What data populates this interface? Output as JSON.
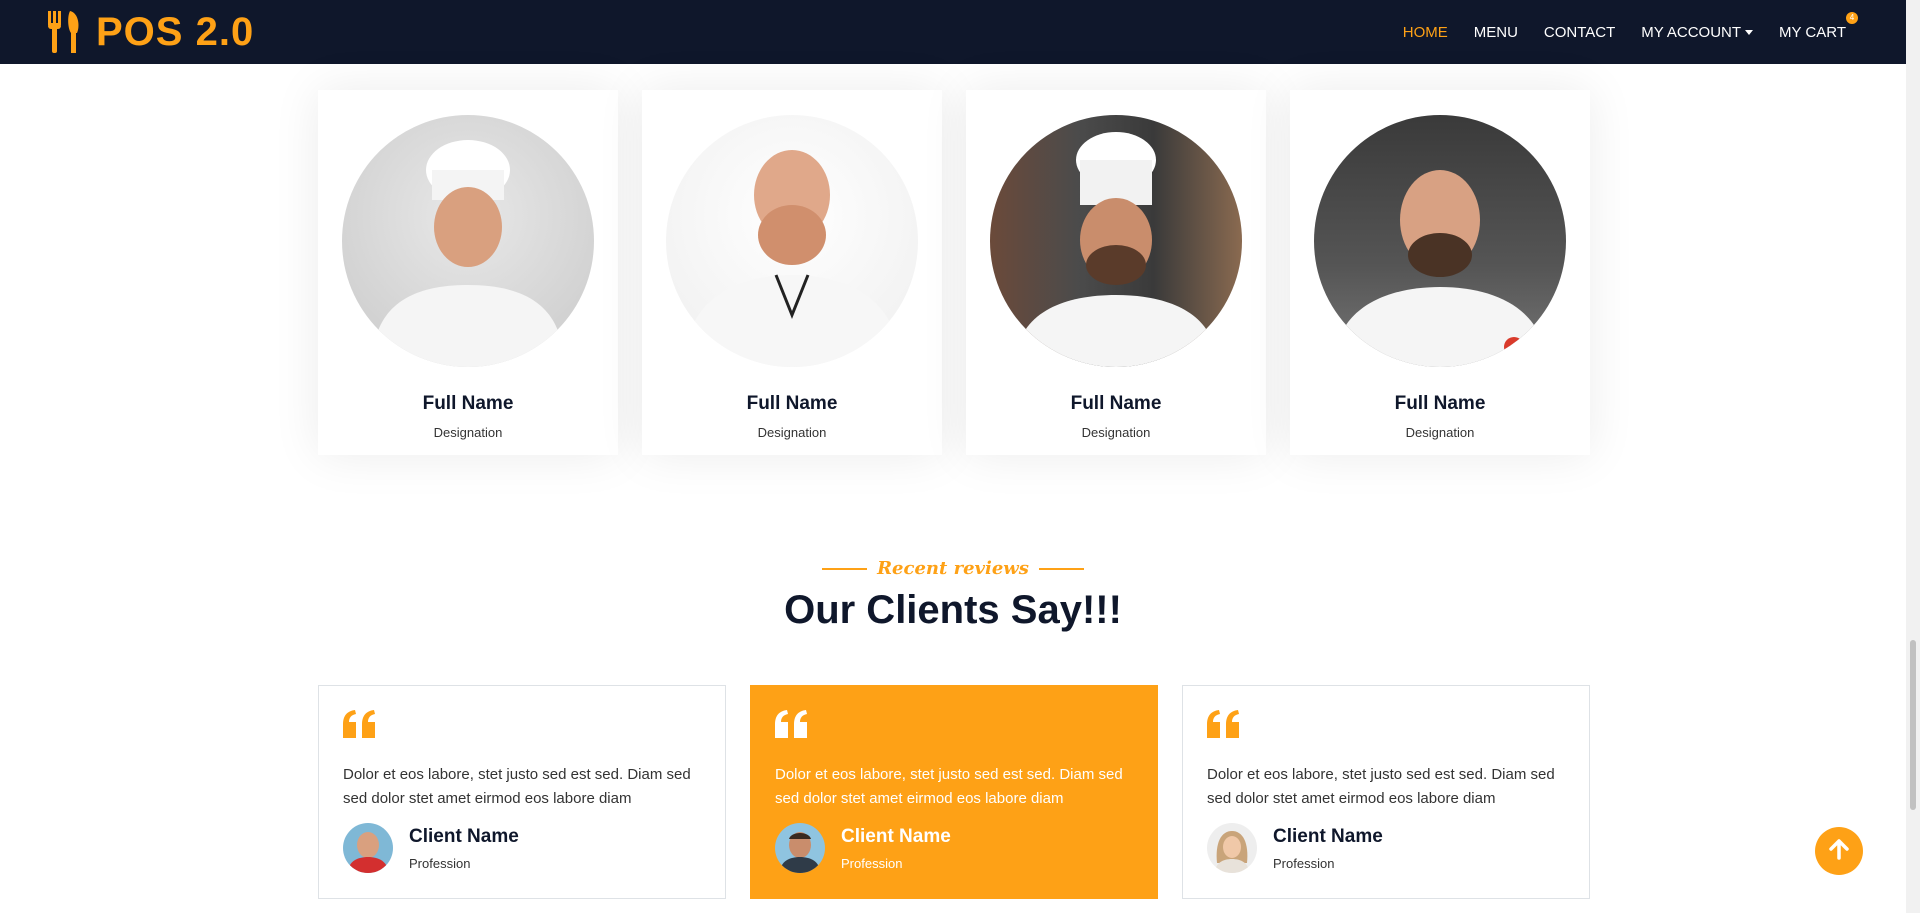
{
  "brand": {
    "title": "POS 2.0",
    "icon": "utensils-icon",
    "accent": "#FEA116",
    "nav_bg": "#0F172B"
  },
  "nav": {
    "home": "HOME",
    "menu": "MENU",
    "contact": "CONTACT",
    "account": "MY ACCOUNT",
    "cart": "MY CART",
    "cart_count": "4"
  },
  "team": [
    {
      "name": "Full Name",
      "role": "Designation"
    },
    {
      "name": "Full Name",
      "role": "Designation"
    },
    {
      "name": "Full Name",
      "role": "Designation"
    },
    {
      "name": "Full Name",
      "role": "Designation"
    }
  ],
  "reviews_section": {
    "subtitle": "Recent reviews",
    "title": "Our Clients Say!!!"
  },
  "reviews": [
    {
      "text": "Dolor et eos labore, stet justo sed est sed. Diam sed sed dolor stet amet eirmod eos labore diam",
      "client": "Client Name",
      "profession": "Profession"
    },
    {
      "text": "Dolor et eos labore, stet justo sed est sed. Diam sed sed dolor stet amet eirmod eos labore diam",
      "client": "Client Name",
      "profession": "Profession"
    },
    {
      "text": "Dolor et eos labore, stet justo sed est sed. Diam sed sed dolor stet amet eirmod eos labore diam",
      "client": "Client Name",
      "profession": "Profession"
    }
  ],
  "back_to_top": {
    "icon": "arrow-up-icon"
  }
}
